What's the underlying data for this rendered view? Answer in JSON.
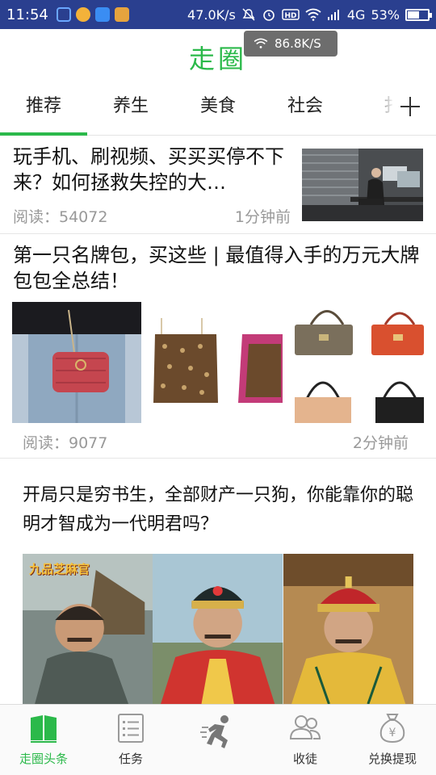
{
  "status_bar": {
    "time": "11:54",
    "network_speed": "47.0K/s",
    "network_type": "4G",
    "battery": "53%",
    "battery_level": 0.53
  },
  "net_toast": {
    "speed": "86.8K/S"
  },
  "header": {
    "title": "走圈"
  },
  "tabs": [
    {
      "label": "推荐",
      "active": true
    },
    {
      "label": "养生",
      "active": false
    },
    {
      "label": "美食",
      "active": false
    },
    {
      "label": "社会",
      "active": false
    },
    {
      "label": "扌",
      "active": false
    }
  ],
  "feed": {
    "item1": {
      "title": "玩手机、刷视频、买买买停不下来？如何拯救失控的大…",
      "reads": "阅读：54072",
      "time": "1分钟前"
    },
    "item2": {
      "title": "第一只名牌包，买这些 | 最值得入手的万元大牌包包全总结！",
      "reads": "阅读：9077",
      "time": "2分钟前"
    },
    "item3": {
      "title": "开局只是穷书生，全部财产一只狗，你能靠你的聪明才智成为一代明君吗？",
      "game_logo": "九品芝麻官"
    }
  },
  "bottom_nav": [
    {
      "label": "走圈头条",
      "active": true,
      "icon": "book-icon"
    },
    {
      "label": "任务",
      "active": false,
      "icon": "list-icon"
    },
    {
      "label": "",
      "active": false,
      "icon": "running-man-icon"
    },
    {
      "label": "收徒",
      "active": false,
      "icon": "users-icon"
    },
    {
      "label": "兑换提现",
      "active": false,
      "icon": "money-bag-icon"
    }
  ],
  "colors": {
    "accent": "#2bb94a",
    "status_bar": "#2a3f8f"
  }
}
